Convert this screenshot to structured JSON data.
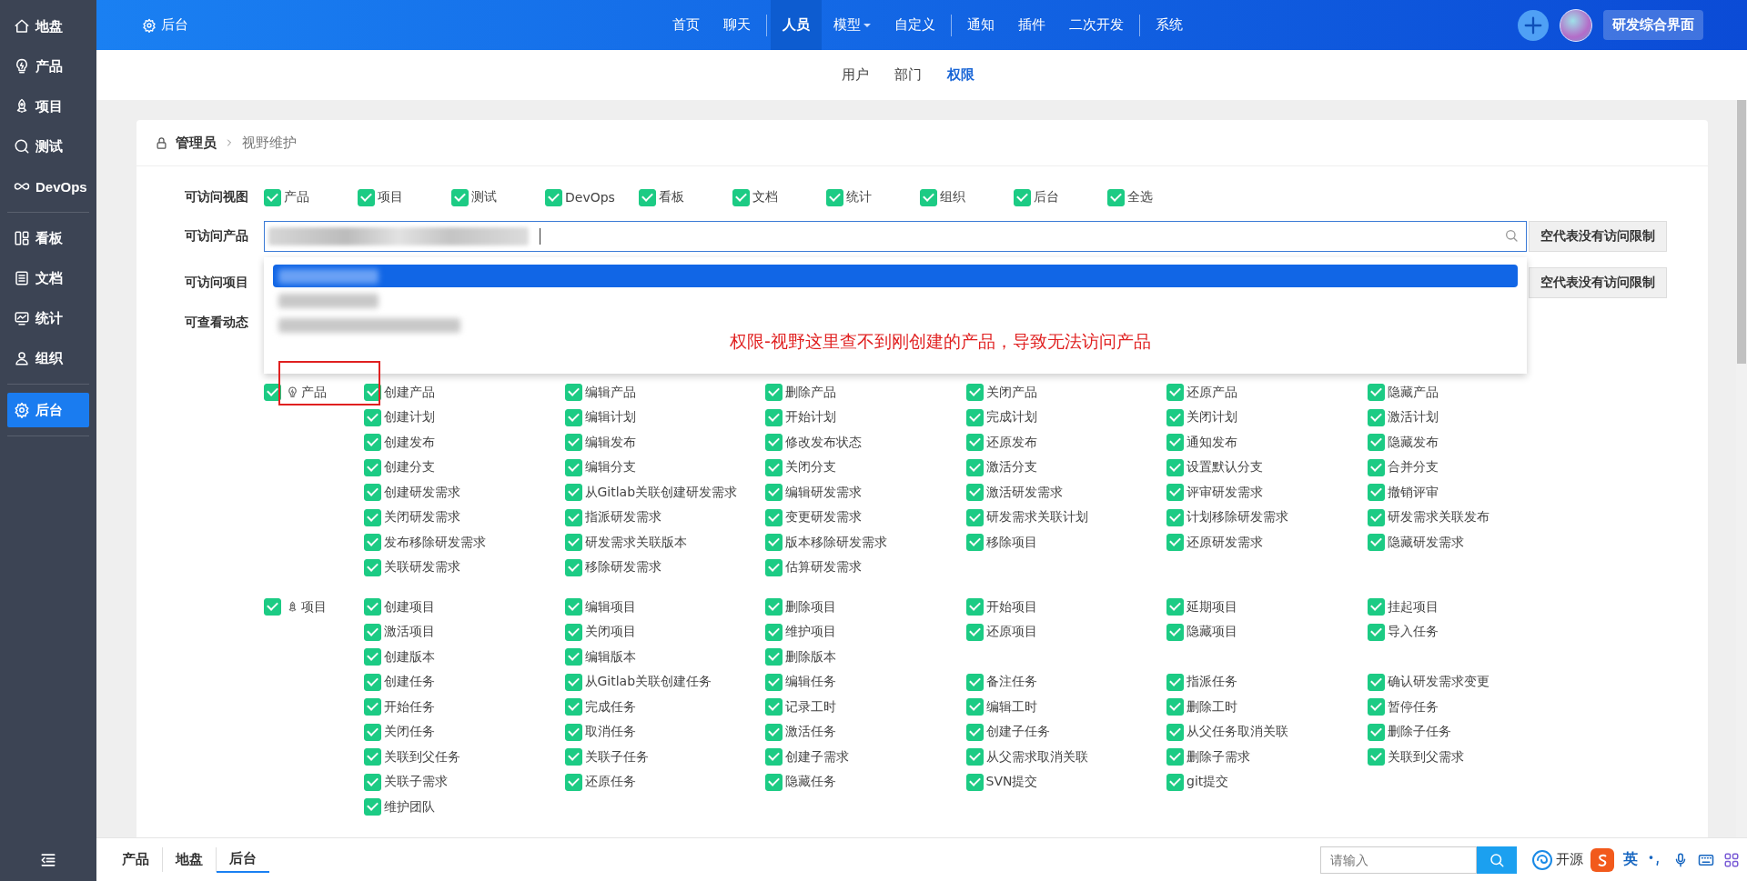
{
  "header": {
    "title": "后台",
    "nav_groups": [
      [
        {
          "label": "首页",
          "selected": false,
          "has_menu": false
        },
        {
          "label": "聊天",
          "selected": false,
          "has_menu": false
        }
      ],
      [
        {
          "label": "人员",
          "selected": true,
          "has_menu": false
        },
        {
          "label": "模型",
          "selected": false,
          "has_menu": true
        },
        {
          "label": "自定义",
          "selected": false,
          "has_menu": false
        }
      ],
      [
        {
          "label": "通知",
          "selected": false,
          "has_menu": false
        },
        {
          "label": "插件",
          "selected": false,
          "has_menu": false
        },
        {
          "label": "二次开发",
          "selected": false,
          "has_menu": false
        }
      ],
      [
        {
          "label": "系统",
          "selected": false,
          "has_menu": false
        }
      ]
    ],
    "primary_button": "研发综合界面"
  },
  "sidebar": {
    "groups": [
      [
        {
          "label": "地盘",
          "selected": false
        },
        {
          "label": "产品",
          "selected": false
        },
        {
          "label": "项目",
          "selected": false
        },
        {
          "label": "测试",
          "selected": false
        },
        {
          "label": "DevOps",
          "selected": false
        }
      ],
      [
        {
          "label": "看板",
          "selected": false
        },
        {
          "label": "文档",
          "selected": false
        },
        {
          "label": "统计",
          "selected": false
        },
        {
          "label": "组织",
          "selected": false
        }
      ],
      [
        {
          "label": "后台",
          "selected": true
        }
      ]
    ]
  },
  "subnav": [
    {
      "label": "用户",
      "selected": false
    },
    {
      "label": "部门",
      "selected": false
    },
    {
      "label": "权限",
      "selected": true
    }
  ],
  "breadcrumb": {
    "root": "管理员",
    "current": "视野维护"
  },
  "view_access": {
    "label": "可访问视图",
    "options": [
      {
        "label": "产品",
        "checked": true
      },
      {
        "label": "项目",
        "checked": true
      },
      {
        "label": "测试",
        "checked": true
      },
      {
        "label": "DevOps",
        "checked": true
      },
      {
        "label": "看板",
        "checked": true
      },
      {
        "label": "文档",
        "checked": true
      },
      {
        "label": "统计",
        "checked": true
      },
      {
        "label": "组织",
        "checked": true
      },
      {
        "label": "后台",
        "checked": true
      },
      {
        "label": "全选",
        "checked": true
      }
    ]
  },
  "product_access": {
    "label": "可访问产品",
    "hint_button": "空代表没有访问限制"
  },
  "project_access": {
    "label": "可访问项目",
    "hint_button": "空代表没有访问限制"
  },
  "activity_access": {
    "label": "可查看动态"
  },
  "dropdown": {
    "options": [
      {
        "selected": true
      },
      {
        "selected": false
      },
      {
        "selected": false
      }
    ]
  },
  "annotation": {
    "text": "权限-视野这里查不到刚创建的产品，导致无法访问产品"
  },
  "permission_groups": [
    {
      "label": "产品",
      "checked": true,
      "rows": [
        [
          {
            "label": "创建产品",
            "checked": true
          },
          {
            "label": "编辑产品",
            "checked": true
          },
          {
            "label": "删除产品",
            "checked": true
          },
          {
            "label": "关闭产品",
            "checked": true
          },
          {
            "label": "还原产品",
            "checked": true
          },
          {
            "label": "隐藏产品",
            "checked": true
          }
        ],
        [
          {
            "label": "创建计划",
            "checked": true
          },
          {
            "label": "编辑计划",
            "checked": true
          },
          {
            "label": "开始计划",
            "checked": true
          },
          {
            "label": "完成计划",
            "checked": true
          },
          {
            "label": "关闭计划",
            "checked": true
          },
          {
            "label": "激活计划",
            "checked": true
          }
        ],
        [
          {
            "label": "创建发布",
            "checked": true
          },
          {
            "label": "编辑发布",
            "checked": true
          },
          {
            "label": "修改发布状态",
            "checked": true
          },
          {
            "label": "还原发布",
            "checked": true
          },
          {
            "label": "通知发布",
            "checked": true
          },
          {
            "label": "隐藏发布",
            "checked": true
          }
        ],
        [
          {
            "label": "创建分支",
            "checked": true
          },
          {
            "label": "编辑分支",
            "checked": true
          },
          {
            "label": "关闭分支",
            "checked": true
          },
          {
            "label": "激活分支",
            "checked": true
          },
          {
            "label": "设置默认分支",
            "checked": true
          },
          {
            "label": "合并分支",
            "checked": true
          }
        ],
        [
          {
            "label": "创建研发需求",
            "checked": true
          },
          {
            "label": "从Gitlab关联创建研发需求",
            "checked": true
          },
          {
            "label": "编辑研发需求",
            "checked": true
          },
          {
            "label": "激活研发需求",
            "checked": true
          },
          {
            "label": "评审研发需求",
            "checked": true
          },
          {
            "label": "撤销评审",
            "checked": true
          }
        ],
        [
          {
            "label": "关闭研发需求",
            "checked": true
          },
          {
            "label": "指派研发需求",
            "checked": true
          },
          {
            "label": "变更研发需求",
            "checked": true
          },
          {
            "label": "研发需求关联计划",
            "checked": true
          },
          {
            "label": "计划移除研发需求",
            "checked": true
          },
          {
            "label": "研发需求关联发布",
            "checked": true
          }
        ],
        [
          {
            "label": "发布移除研发需求",
            "checked": true
          },
          {
            "label": "研发需求关联版本",
            "checked": true
          },
          {
            "label": "版本移除研发需求",
            "checked": true
          },
          {
            "label": "移除项目",
            "checked": true
          },
          {
            "label": "还原研发需求",
            "checked": true
          },
          {
            "label": "隐藏研发需求",
            "checked": true
          }
        ],
        [
          {
            "label": "关联研发需求",
            "checked": true
          },
          {
            "label": "移除研发需求",
            "checked": true
          },
          {
            "label": "估算研发需求",
            "checked": true
          }
        ]
      ]
    },
    {
      "label": "项目",
      "checked": true,
      "rows": [
        [
          {
            "label": "创建项目",
            "checked": true
          },
          {
            "label": "编辑项目",
            "checked": true
          },
          {
            "label": "删除项目",
            "checked": true
          },
          {
            "label": "开始项目",
            "checked": true
          },
          {
            "label": "延期项目",
            "checked": true
          },
          {
            "label": "挂起项目",
            "checked": true
          }
        ],
        [
          {
            "label": "激活项目",
            "checked": true
          },
          {
            "label": "关闭项目",
            "checked": true
          },
          {
            "label": "维护项目",
            "checked": true
          },
          {
            "label": "还原项目",
            "checked": true
          },
          {
            "label": "隐藏项目",
            "checked": true
          },
          {
            "label": "导入任务",
            "checked": true
          }
        ],
        [
          {
            "label": "创建版本",
            "checked": true
          },
          {
            "label": "编辑版本",
            "checked": true
          },
          {
            "label": "删除版本",
            "checked": true
          }
        ],
        [
          {
            "label": "创建任务",
            "checked": true
          },
          {
            "label": "从Gitlab关联创建任务",
            "checked": true
          },
          {
            "label": "编辑任务",
            "checked": true
          },
          {
            "label": "备注任务",
            "checked": true
          },
          {
            "label": "指派任务",
            "checked": true
          },
          {
            "label": "确认研发需求变更",
            "checked": true
          }
        ],
        [
          {
            "label": "开始任务",
            "checked": true
          },
          {
            "label": "完成任务",
            "checked": true
          },
          {
            "label": "记录工时",
            "checked": true
          },
          {
            "label": "编辑工时",
            "checked": true
          },
          {
            "label": "删除工时",
            "checked": true
          },
          {
            "label": "暂停任务",
            "checked": true
          }
        ],
        [
          {
            "label": "关闭任务",
            "checked": true
          },
          {
            "label": "取消任务",
            "checked": true
          },
          {
            "label": "激活任务",
            "checked": true
          },
          {
            "label": "创建子任务",
            "checked": true
          },
          {
            "label": "从父任务取消关联",
            "checked": true
          },
          {
            "label": "删除子任务",
            "checked": true
          }
        ],
        [
          {
            "label": "关联到父任务",
            "checked": true
          },
          {
            "label": "关联子任务",
            "checked": true
          },
          {
            "label": "创建子需求",
            "checked": true
          },
          {
            "label": "从父需求取消关联",
            "checked": true
          },
          {
            "label": "删除子需求",
            "checked": true
          },
          {
            "label": "关联到父需求",
            "checked": true
          }
        ],
        [
          {
            "label": "关联子需求",
            "checked": true
          },
          {
            "label": "还原任务",
            "checked": true
          },
          {
            "label": "隐藏任务",
            "checked": true
          },
          {
            "label": "SVN提交",
            "checked": true
          },
          {
            "label": "git提交",
            "checked": true
          }
        ],
        [
          {
            "label": "维护团队",
            "checked": true
          }
        ]
      ]
    }
  ],
  "bottom_tabs": [
    {
      "label": "产品",
      "selected": false
    },
    {
      "label": "地盘",
      "selected": false
    },
    {
      "label": "后台",
      "selected": true
    }
  ],
  "bottom_search": {
    "placeholder": "请输入"
  },
  "brand": {
    "label": "开源"
  },
  "ime": {
    "language": "英"
  }
}
